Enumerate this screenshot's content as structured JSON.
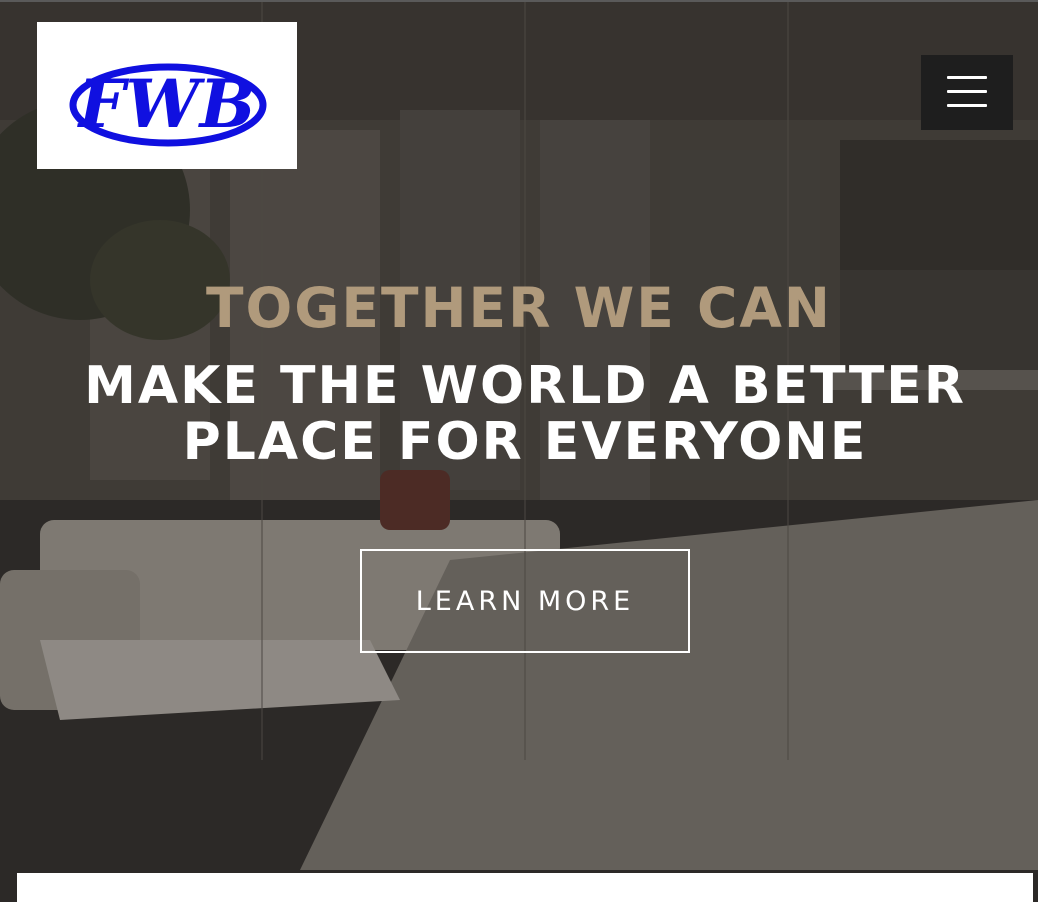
{
  "header": {
    "logo_text": "FWB",
    "logo_color": "#1010e0",
    "menu_icon": "hamburger-menu-icon"
  },
  "hero": {
    "tagline": "TOGETHER WE CAN",
    "headline": "MAKE THE WORLD A BETTER PLACE FOR EVERYONE",
    "button_label": "LEARN MORE",
    "accent_color": "#b09a7c"
  }
}
